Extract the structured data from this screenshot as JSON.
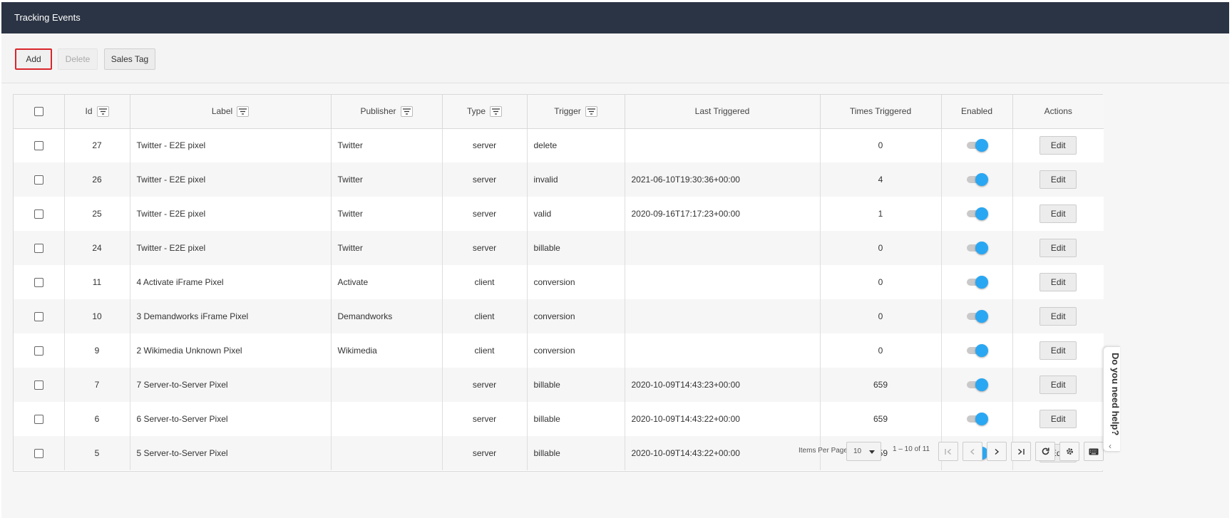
{
  "title": "Tracking Events",
  "toolbar": {
    "add": "Add",
    "delete": "Delete",
    "sales_tag": "Sales Tag"
  },
  "columns": {
    "id": "Id",
    "label": "Label",
    "publisher": "Publisher",
    "type": "Type",
    "trigger": "Trigger",
    "last_triggered": "Last Triggered",
    "times_triggered": "Times Triggered",
    "enabled": "Enabled",
    "actions": "Actions"
  },
  "rows": [
    {
      "id": "27",
      "label": "Twitter - E2E pixel",
      "publisher": "Twitter",
      "type": "server",
      "trigger": "delete",
      "last_triggered": "",
      "times_triggered": "0",
      "enabled": true,
      "action": "Edit"
    },
    {
      "id": "26",
      "label": "Twitter - E2E pixel",
      "publisher": "Twitter",
      "type": "server",
      "trigger": "invalid",
      "last_triggered": "2021-06-10T19:30:36+00:00",
      "times_triggered": "4",
      "enabled": true,
      "action": "Edit"
    },
    {
      "id": "25",
      "label": "Twitter - E2E pixel",
      "publisher": "Twitter",
      "type": "server",
      "trigger": "valid",
      "last_triggered": "2020-09-16T17:17:23+00:00",
      "times_triggered": "1",
      "enabled": true,
      "action": "Edit"
    },
    {
      "id": "24",
      "label": "Twitter - E2E pixel",
      "publisher": "Twitter",
      "type": "server",
      "trigger": "billable",
      "last_triggered": "",
      "times_triggered": "0",
      "enabled": true,
      "action": "Edit"
    },
    {
      "id": "11",
      "label": "4 Activate iFrame Pixel",
      "publisher": "Activate",
      "type": "client",
      "trigger": "conversion",
      "last_triggered": "",
      "times_triggered": "0",
      "enabled": true,
      "action": "Edit"
    },
    {
      "id": "10",
      "label": "3 Demandworks iFrame Pixel",
      "publisher": "Demandworks",
      "type": "client",
      "trigger": "conversion",
      "last_triggered": "",
      "times_triggered": "0",
      "enabled": true,
      "action": "Edit"
    },
    {
      "id": "9",
      "label": "2 Wikimedia Unknown Pixel",
      "publisher": "Wikimedia",
      "type": "client",
      "trigger": "conversion",
      "last_triggered": "",
      "times_triggered": "0",
      "enabled": true,
      "action": "Edit"
    },
    {
      "id": "7",
      "label": "7 Server-to-Server Pixel",
      "publisher": "",
      "type": "server",
      "trigger": "billable",
      "last_triggered": "2020-10-09T14:43:23+00:00",
      "times_triggered": "659",
      "enabled": true,
      "action": "Edit"
    },
    {
      "id": "6",
      "label": "6 Server-to-Server Pixel",
      "publisher": "",
      "type": "server",
      "trigger": "billable",
      "last_triggered": "2020-10-09T14:43:22+00:00",
      "times_triggered": "659",
      "enabled": true,
      "action": "Edit"
    },
    {
      "id": "5",
      "label": "5 Server-to-Server Pixel",
      "publisher": "",
      "type": "server",
      "trigger": "billable",
      "last_triggered": "2020-10-09T14:43:22+00:00",
      "times_triggered": "659",
      "enabled": true,
      "action": "Edit"
    }
  ],
  "pager": {
    "items_per_page_label": "Items Per Page:",
    "items_per_page": "10",
    "range": "1 – 10 of 11"
  },
  "help_tab": "Do you need help?",
  "colors": {
    "header_bg": "#2b3444",
    "toggle_on": "#2aa7f2",
    "add_highlight": "#d9262c"
  }
}
